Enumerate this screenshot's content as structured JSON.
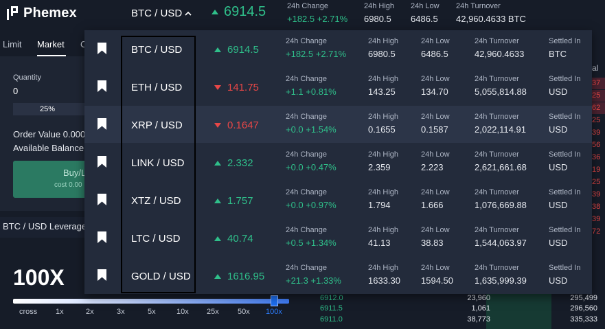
{
  "header": {
    "logo_text": "Phemex",
    "pair_selector": "BTC / USD",
    "last_price": "6914.5",
    "stats": [
      {
        "label": "24h Change",
        "value": "+182.5 +2.71%"
      },
      {
        "label": "24h High",
        "value": "6980.5"
      },
      {
        "label": "24h Low",
        "value": "6486.5"
      },
      {
        "label": "24h Turnover",
        "value": "42,960.4633 BTC"
      }
    ]
  },
  "order_panel": {
    "tabs": [
      "Limit",
      "Market",
      "C"
    ],
    "active_tab": "Market",
    "quantity_label": "Quantity",
    "quantity_value": "0",
    "percent_label": "25%",
    "order_value_label": "Order Value 0.000",
    "available_balance_label": "Available Balance",
    "buy_label": "Buy/L",
    "cost_label": "cost 0.00",
    "leverage_title": "BTC / USD Leverage",
    "leverage_value": "100X",
    "leverage_ticks": [
      "cross",
      "1x",
      "2x",
      "3x",
      "5x",
      "10x",
      "25x",
      "50x",
      "100x"
    ],
    "active_tick": "100x"
  },
  "right_strip": {
    "label": "al",
    "numbers": [
      "37",
      "25",
      "62",
      "25",
      "39",
      "56",
      "36",
      "19",
      "25",
      "39",
      "38",
      "39",
      "72"
    ]
  },
  "order_book_rows": [
    {
      "price": "6912.0",
      "size": "23,960",
      "total": "295,499"
    },
    {
      "price": "6911.5",
      "size": "1,061",
      "total": "296,560"
    },
    {
      "price": "6911.0",
      "size": "38,773",
      "total": "335,333"
    }
  ],
  "dropdown": {
    "columns": {
      "change": "24h Change",
      "high": "24h High",
      "low": "24h Low",
      "turnover": "24h Turnover",
      "settled": "Settled In"
    },
    "rows": [
      {
        "symbol": "BTC / USD",
        "last": "6914.5",
        "direction": "up",
        "change": "+182.5 +2.71%",
        "high": "6980.5",
        "low": "6486.5",
        "turnover": "42,960.4633",
        "settled": "BTC"
      },
      {
        "symbol": "ETH / USD",
        "last": "141.75",
        "direction": "down",
        "change": "+1.1 +0.81%",
        "high": "143.25",
        "low": "134.70",
        "turnover": "5,055,814.88",
        "settled": "USD"
      },
      {
        "symbol": "XRP / USD",
        "last": "0.1647",
        "direction": "down",
        "change": "+0.0 +1.54%",
        "high": "0.1655",
        "low": "0.1587",
        "turnover": "2,022,114.91",
        "settled": "USD"
      },
      {
        "symbol": "LINK / USD",
        "last": "2.332",
        "direction": "up",
        "change": "+0.0 +0.47%",
        "high": "2.359",
        "low": "2.223",
        "turnover": "2,621,661.68",
        "settled": "USD"
      },
      {
        "symbol": "XTZ / USD",
        "last": "1.757",
        "direction": "up",
        "change": "+0.0 +0.97%",
        "high": "1.794",
        "low": "1.666",
        "turnover": "1,076,669.88",
        "settled": "USD"
      },
      {
        "symbol": "LTC / USD",
        "last": "40.74",
        "direction": "up",
        "change": "+0.5 +1.34%",
        "high": "41.13",
        "low": "38.83",
        "turnover": "1,544,063.97",
        "settled": "USD"
      },
      {
        "symbol": "GOLD / USD",
        "last": "1616.95",
        "direction": "up",
        "change": "+21.3 +1.33%",
        "high": "1633.30",
        "low": "1594.50",
        "turnover": "1,635,999.39",
        "settled": "USD"
      }
    ]
  },
  "colors": {
    "up": "#2fbf8a",
    "down": "#e84747",
    "accent": "#2c7dff",
    "panel": "#232b3b",
    "highlight_row": "#2c3548"
  }
}
